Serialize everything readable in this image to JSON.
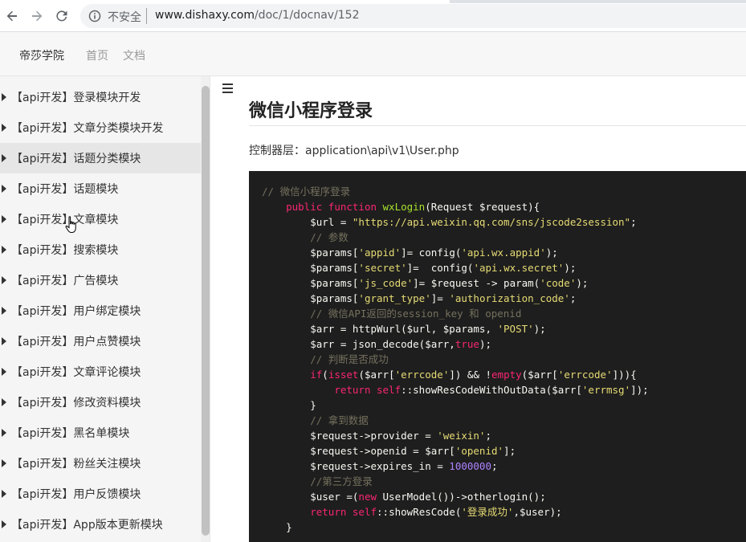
{
  "browser": {
    "security_label": "不安全",
    "url_host": "www.dishaxy.com",
    "url_path": "/doc/1/docnav/152"
  },
  "header": {
    "brand": "帝莎学院",
    "nav": [
      "首页",
      "文档"
    ]
  },
  "sidebar": {
    "items": [
      {
        "label": "【api开发】登录模块开发"
      },
      {
        "label": "【api开发】文章分类模块开发"
      },
      {
        "label": "【api开发】话题分类模块"
      },
      {
        "label": "【api开发】话题模块"
      },
      {
        "label": "【api开发】文章模块"
      },
      {
        "label": "【api开发】搜索模块"
      },
      {
        "label": "【api开发】广告模块"
      },
      {
        "label": "【api开发】用户绑定模块"
      },
      {
        "label": "【api开发】用户点赞模块"
      },
      {
        "label": "【api开发】文章评论模块"
      },
      {
        "label": "【api开发】修改资料模块"
      },
      {
        "label": "【api开发】黑名单模块"
      },
      {
        "label": "【api开发】粉丝关注模块"
      },
      {
        "label": "【api开发】用户反馈模块"
      },
      {
        "label": "【api开发】App版本更新模块"
      }
    ],
    "active_index": 2
  },
  "main": {
    "title": "微信小程序登录",
    "controller_line": "控制器层：application\\api\\v1\\User.php",
    "code": [
      [
        [
          "c-comment",
          "// 微信小程序登录"
        ]
      ],
      [
        [
          "c-plain",
          "    "
        ],
        [
          "c-kw",
          "public function"
        ],
        [
          "c-plain",
          " "
        ],
        [
          "c-fn",
          "wxLogin"
        ],
        [
          "c-plain",
          "(Request $request){"
        ]
      ],
      [
        [
          "c-plain",
          "        $url = "
        ],
        [
          "c-str",
          "\"https://api.weixin.qq.com/sns/jscode2session\""
        ],
        [
          "c-plain",
          ";"
        ]
      ],
      [
        [
          "c-plain",
          "        "
        ],
        [
          "c-comment",
          "// 参数"
        ]
      ],
      [
        [
          "c-plain",
          "        $params["
        ],
        [
          "c-str",
          "'appid'"
        ],
        [
          "c-plain",
          "]= config("
        ],
        [
          "c-str",
          "'api.wx.appid'"
        ],
        [
          "c-plain",
          ");"
        ]
      ],
      [
        [
          "c-plain",
          "        $params["
        ],
        [
          "c-str",
          "'secret'"
        ],
        [
          "c-plain",
          "]=  config("
        ],
        [
          "c-str",
          "'api.wx.secret'"
        ],
        [
          "c-plain",
          ");"
        ]
      ],
      [
        [
          "c-plain",
          "        $params["
        ],
        [
          "c-str",
          "'js_code'"
        ],
        [
          "c-plain",
          "]= $request -> param("
        ],
        [
          "c-str",
          "'code'"
        ],
        [
          "c-plain",
          ");"
        ]
      ],
      [
        [
          "c-plain",
          "        $params["
        ],
        [
          "c-str",
          "'grant_type'"
        ],
        [
          "c-plain",
          "]= "
        ],
        [
          "c-str",
          "'authorization_code'"
        ],
        [
          "c-plain",
          ";"
        ]
      ],
      [
        [
          "c-plain",
          "        "
        ],
        [
          "c-comment",
          "// 微信API返回的session_key 和 openid"
        ]
      ],
      [
        [
          "c-plain",
          "        $arr = httpWurl($url, $params, "
        ],
        [
          "c-str",
          "'POST'"
        ],
        [
          "c-plain",
          ");"
        ]
      ],
      [
        [
          "c-plain",
          "        $arr = json_decode($arr,"
        ],
        [
          "c-kw",
          "true"
        ],
        [
          "c-plain",
          ");"
        ]
      ],
      [
        [
          "c-plain",
          "        "
        ],
        [
          "c-comment",
          "// 判断是否成功"
        ]
      ],
      [
        [
          "c-plain",
          "        "
        ],
        [
          "c-kw",
          "if"
        ],
        [
          "c-plain",
          "("
        ],
        [
          "c-kw",
          "isset"
        ],
        [
          "c-plain",
          "($arr["
        ],
        [
          "c-str",
          "'errcode'"
        ],
        [
          "c-plain",
          "]) && !"
        ],
        [
          "c-kw",
          "empty"
        ],
        [
          "c-plain",
          "($arr["
        ],
        [
          "c-str",
          "'errcode'"
        ],
        [
          "c-plain",
          "])){"
        ]
      ],
      [
        [
          "c-plain",
          "            "
        ],
        [
          "c-kw",
          "return"
        ],
        [
          "c-plain",
          " "
        ],
        [
          "c-kw",
          "self"
        ],
        [
          "c-plain",
          "::showResCodeWithOutData($arr["
        ],
        [
          "c-str",
          "'errmsg'"
        ],
        [
          "c-plain",
          "]);"
        ]
      ],
      [
        [
          "c-plain",
          "        }"
        ]
      ],
      [
        [
          "c-plain",
          "        "
        ],
        [
          "c-comment",
          "// 拿到数据"
        ]
      ],
      [
        [
          "c-plain",
          "        $request->provider = "
        ],
        [
          "c-str",
          "'weixin'"
        ],
        [
          "c-plain",
          ";"
        ]
      ],
      [
        [
          "c-plain",
          "        $request->openid = $arr["
        ],
        [
          "c-str",
          "'openid'"
        ],
        [
          "c-plain",
          "];"
        ]
      ],
      [
        [
          "c-plain",
          "        $request->expires_in = "
        ],
        [
          "c-num",
          "1000000"
        ],
        [
          "c-plain",
          ";"
        ]
      ],
      [
        [
          "c-plain",
          "        "
        ],
        [
          "c-comment",
          "//第三方登录"
        ]
      ],
      [
        [
          "c-plain",
          "        $user =("
        ],
        [
          "c-kw",
          "new"
        ],
        [
          "c-plain",
          " UserModel())->otherlogin();"
        ]
      ],
      [
        [
          "c-plain",
          "        "
        ],
        [
          "c-kw",
          "return"
        ],
        [
          "c-plain",
          " "
        ],
        [
          "c-kw",
          "self"
        ],
        [
          "c-plain",
          "::showResCode("
        ],
        [
          "c-str",
          "'登录成功'"
        ],
        [
          "c-plain",
          ",$user);"
        ]
      ],
      [
        [
          "c-plain",
          "    }"
        ]
      ]
    ]
  }
}
